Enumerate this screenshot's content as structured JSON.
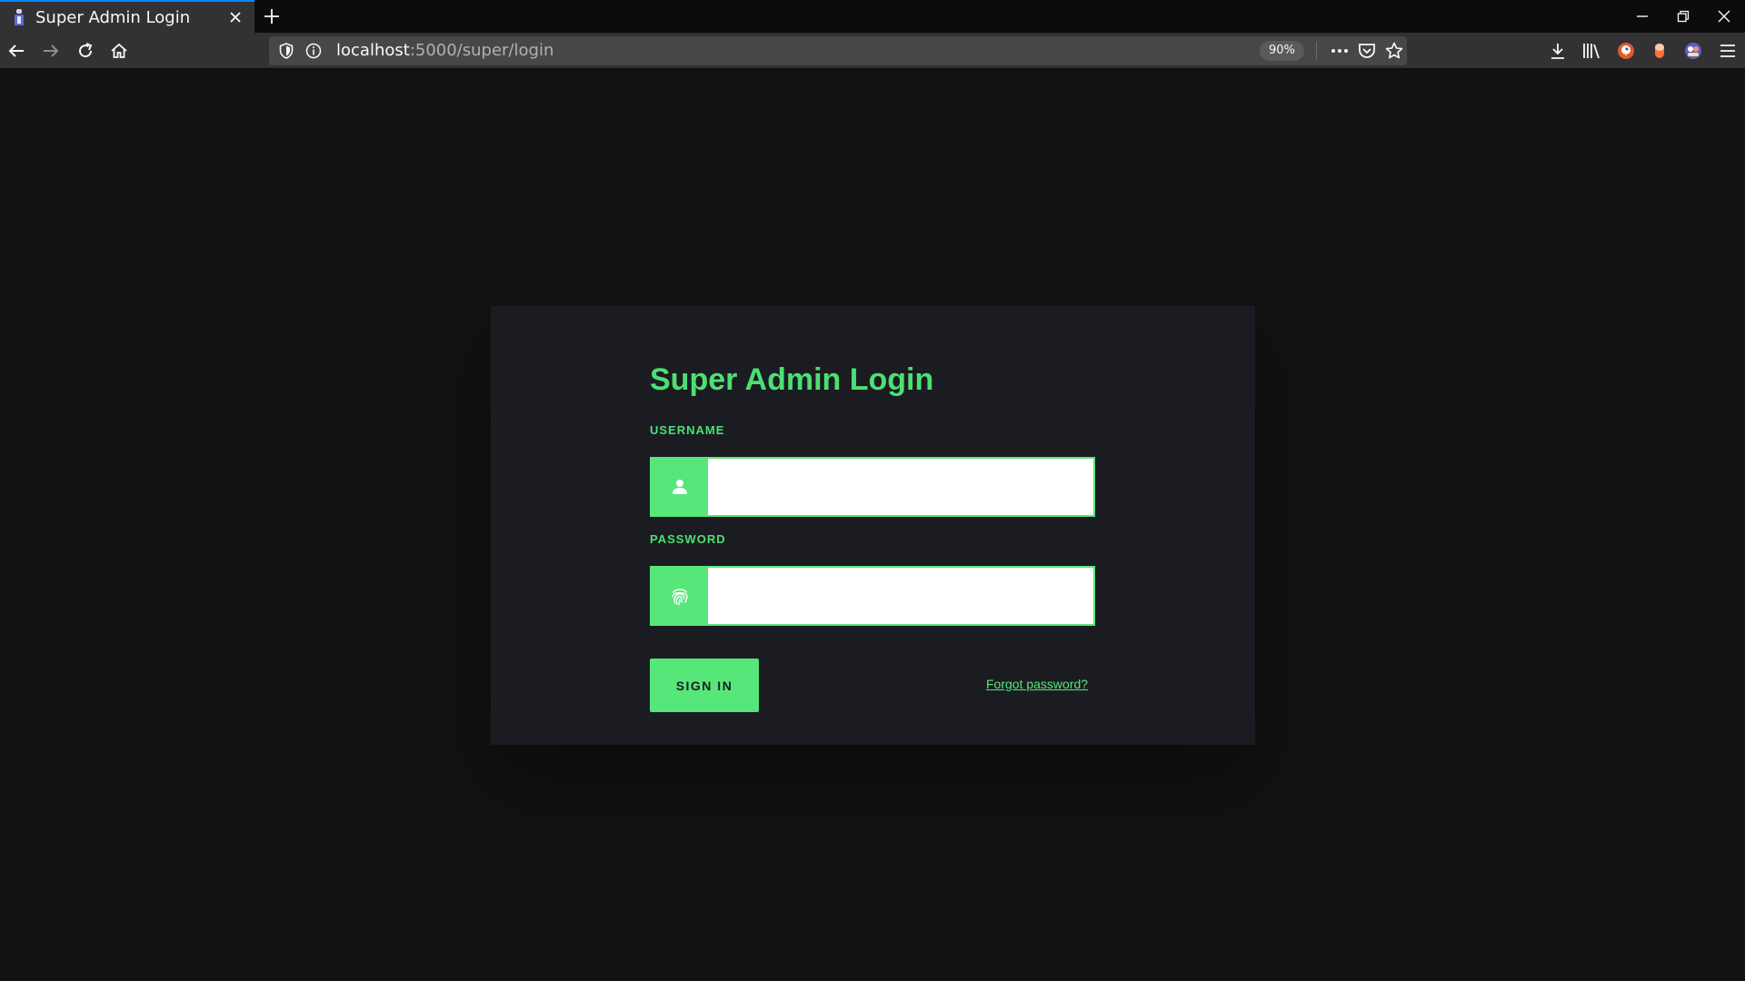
{
  "browser": {
    "tab_title": "Super Admin Login",
    "url_host": "localhost",
    "url_path": ":5000/super/login",
    "zoom": "90%"
  },
  "page": {
    "title": "Super Admin Login",
    "username_label": "USERNAME",
    "password_label": "PASSWORD",
    "username_value": "",
    "password_value": "",
    "signin_label": "SIGN IN",
    "forgot_label": "Forgot password?"
  },
  "colors": {
    "accent": "#57e67a",
    "card_bg": "#1b1c22",
    "page_bg": "#121212",
    "chrome_bg": "#323234"
  }
}
